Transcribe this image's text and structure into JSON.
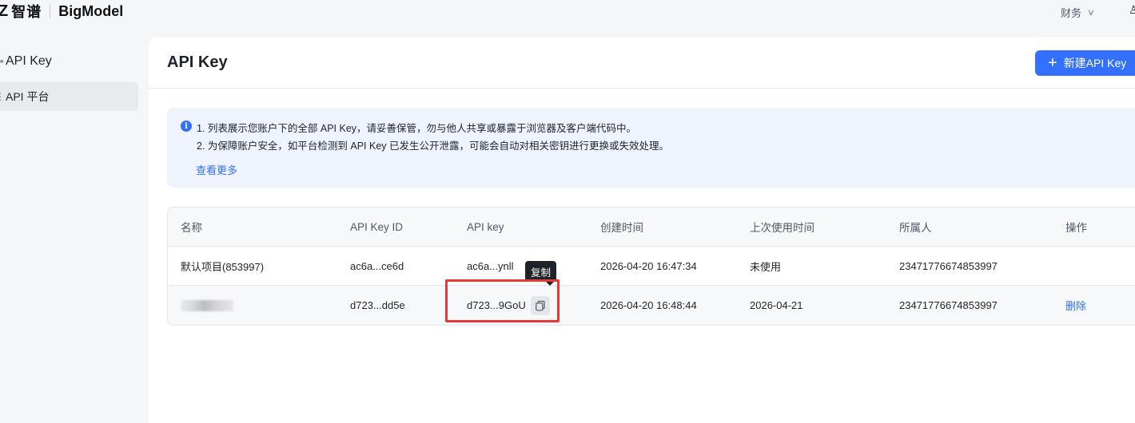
{
  "topbar": {
    "logo_mark": "Z",
    "logo_cn": "智谱",
    "logo_en": "BigModel",
    "finance_label": "财务"
  },
  "sidebar": {
    "group_label": "API Key",
    "items": [
      {
        "label": "API 平台",
        "active": true
      }
    ]
  },
  "page": {
    "title": "API Key",
    "new_button": "新建API Key"
  },
  "notice": {
    "line1": "1. 列表展示您账户下的全部 API Key，请妥善保管，勿与他人共享或暴露于浏览器及客户端代码中。",
    "line2": "2. 为保障账户安全，如平台检测到 API Key 已发生公开泄露，可能会自动对相关密钥进行更换或失效处理。",
    "more_link": "查看更多"
  },
  "table": {
    "headers": [
      "名称",
      "API Key ID",
      "API key",
      "创建时间",
      "上次使用时间",
      "所属人",
      "操作"
    ],
    "rows": [
      {
        "name": "默认项目(853997)",
        "id": "ac6a...ce6d",
        "key": "ac6a...ynll",
        "created": "2026-04-20 16:47:34",
        "last_used": "未使用",
        "owner": "23471776674853997",
        "action": ""
      },
      {
        "name": "",
        "name_redacted": true,
        "id": "d723...dd5e",
        "key": "d723...9GoU",
        "created": "2026-04-20 16:48:44",
        "last_used": "2026-04-21",
        "owner": "23471776674853997",
        "action": "删除"
      }
    ]
  },
  "tooltip": {
    "text": "复制"
  },
  "colors": {
    "accent": "#3370ff",
    "highlight": "#e53935"
  }
}
